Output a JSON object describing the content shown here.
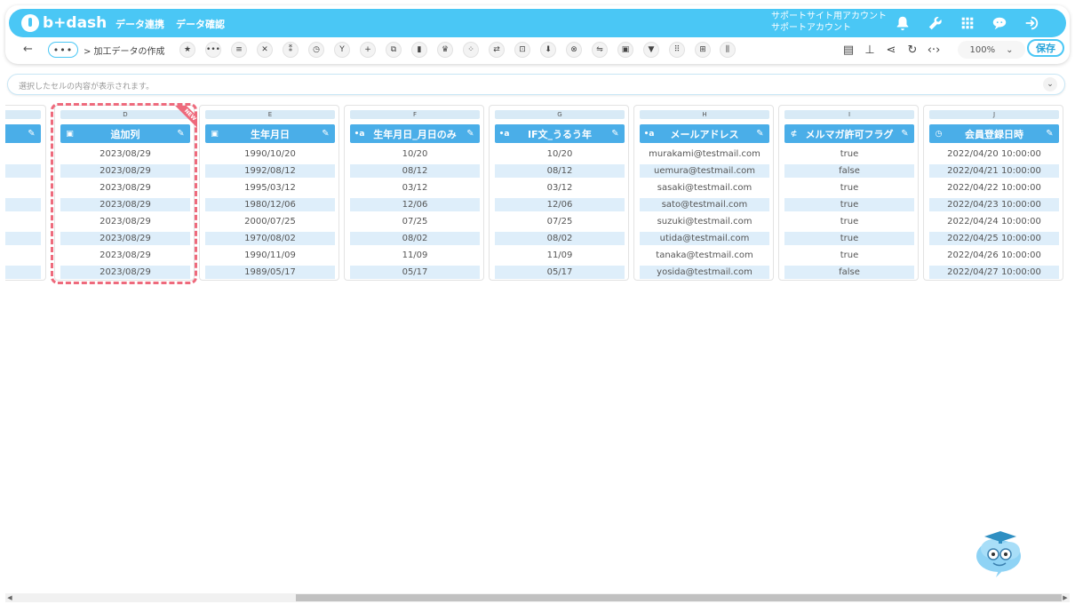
{
  "header": {
    "logo": "b+dash",
    "nav": [
      "データ連携",
      "データ確認"
    ],
    "account_line1": "サポートサイト用アカウント",
    "account_line2": "サポートアカウント"
  },
  "toolbar": {
    "back": "←",
    "more": "•••",
    "breadcrumb": "> 加工データの作成",
    "zoom": "100%",
    "zoom_chevron": "⌄",
    "save": "保存"
  },
  "cellbar": {
    "placeholder": "選択したセルの内容が表示されます。",
    "chevron": "⌄"
  },
  "new_badge": "NEW",
  "columns": [
    {
      "letter": "D",
      "title": "追加列",
      "type_icon": "calendar-icon",
      "rows": [
        "2023/08/29",
        "2023/08/29",
        "2023/08/29",
        "2023/08/29",
        "2023/08/29",
        "2023/08/29",
        "2023/08/29",
        "2023/08/29"
      ]
    },
    {
      "letter": "E",
      "title": "生年月日",
      "type_icon": "calendar-icon",
      "rows": [
        "1990/10/20",
        "1992/08/12",
        "1995/03/12",
        "1980/12/06",
        "2000/07/25",
        "1970/08/02",
        "1990/11/09",
        "1989/05/17"
      ]
    },
    {
      "letter": "F",
      "title": "生年月日_月日のみ",
      "type_icon": "text-type-icon",
      "rows": [
        "10/20",
        "08/12",
        "03/12",
        "12/06",
        "07/25",
        "08/02",
        "11/09",
        "05/17"
      ]
    },
    {
      "letter": "G",
      "title": "IF文_うるう年",
      "type_icon": "text-type-icon",
      "rows": [
        "10/20",
        "08/12",
        "03/12",
        "12/06",
        "07/25",
        "08/02",
        "11/09",
        "05/17"
      ]
    },
    {
      "letter": "H",
      "title": "メールアドレス",
      "type_icon": "text-type-icon",
      "rows": [
        "murakami@testmail.com",
        "uemura@testmail.com",
        "sasaki@testmail.com",
        "sato@testmail.com",
        "suzuki@testmail.com",
        "utida@testmail.com",
        "tanaka@testmail.com",
        "yosida@testmail.com"
      ]
    },
    {
      "letter": "I",
      "title": "メルマガ許可フラグ",
      "type_icon": "boolean-type-icon",
      "rows": [
        "true",
        "false",
        "true",
        "true",
        "true",
        "true",
        "true",
        "false"
      ]
    },
    {
      "letter": "J",
      "title": "会員登録日時",
      "type_icon": "clock-icon",
      "rows": [
        "2022/04/20 10:00:00",
        "2022/04/21 10:00:00",
        "2022/04/22 10:00:00",
        "2022/04/23 10:00:00",
        "2022/04/24 10:00:00",
        "2022/04/25 10:00:00",
        "2022/04/26 10:00:00",
        "2022/04/27 10:00:00"
      ]
    }
  ],
  "colors": {
    "brand": "#4ac7f5",
    "column_header": "#4aaee8",
    "row_alt": "#deeefa",
    "highlight_dash": "#ee6a7c"
  }
}
